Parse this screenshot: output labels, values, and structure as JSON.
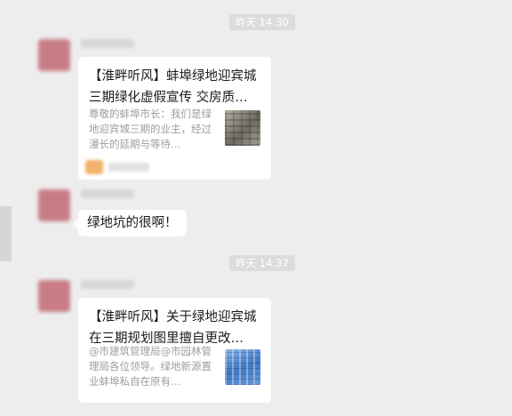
{
  "timestamps": [
    "昨天 14:30",
    "昨天 14:37"
  ],
  "messages": [
    {
      "type": "article",
      "title": "【淮畔听风】蚌埠绿地迎宾城三期绿化虚假宣传 交房质…",
      "description": "尊敬的蚌埠市长：我们是绿地迎宾城三期的业主，经过漫长的延期与等待…",
      "thumbnail_icon": "photo-thumbnail-icon"
    },
    {
      "type": "text",
      "text": "绿地坑的很啊！"
    },
    {
      "type": "article",
      "title": "【淮畔听风】关于绿地迎宾城在三期规划图里擅自更改…",
      "description": "@市建筑管理局@市园林管理局各位领导。绿地新源置业蚌埠私自在原有…",
      "thumbnail_icon": "document-thumbnail-icon"
    }
  ],
  "colors": {
    "background": "#ededed",
    "bubble": "#ffffff",
    "timestamp_pill": "#dcdcdc",
    "avatar_tint": "#c87d86"
  }
}
